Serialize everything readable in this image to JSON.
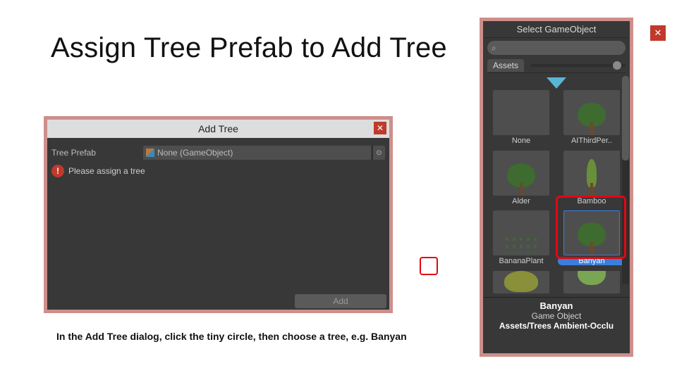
{
  "slide": {
    "title": "Assign Tree Prefab to Add Tree",
    "caption": "In the Add Tree dialog, click the tiny circle, then choose a tree, e.g. Banyan"
  },
  "addTree": {
    "title": "Add Tree",
    "close_glyph": "✕",
    "field_label": "Tree Prefab",
    "field_value": "None (GameObject)",
    "picker_glyph": "⊙",
    "warning_text": "Please assign a tree",
    "warning_glyph": "!",
    "add_label": "Add"
  },
  "selectGO": {
    "title": "Select GameObject",
    "close_glyph": "✕",
    "search_glyph": "⌕",
    "search_placeholder": "",
    "tab_label": "Assets",
    "items": [
      {
        "label": "None",
        "kind": "none"
      },
      {
        "label": "AIThirdPer..",
        "kind": "round"
      },
      {
        "label": "Alder",
        "kind": "round"
      },
      {
        "label": "Bamboo",
        "kind": "tall"
      },
      {
        "label": "BananaPlant",
        "kind": "fern"
      },
      {
        "label": "Banyan",
        "kind": "round",
        "selected": true
      },
      {
        "label": "",
        "kind": "bush"
      },
      {
        "label": "",
        "kind": "light"
      }
    ],
    "details": {
      "name": "Banyan",
      "type": "Game Object",
      "path": "Assets/Trees Ambient-Occlu"
    }
  }
}
